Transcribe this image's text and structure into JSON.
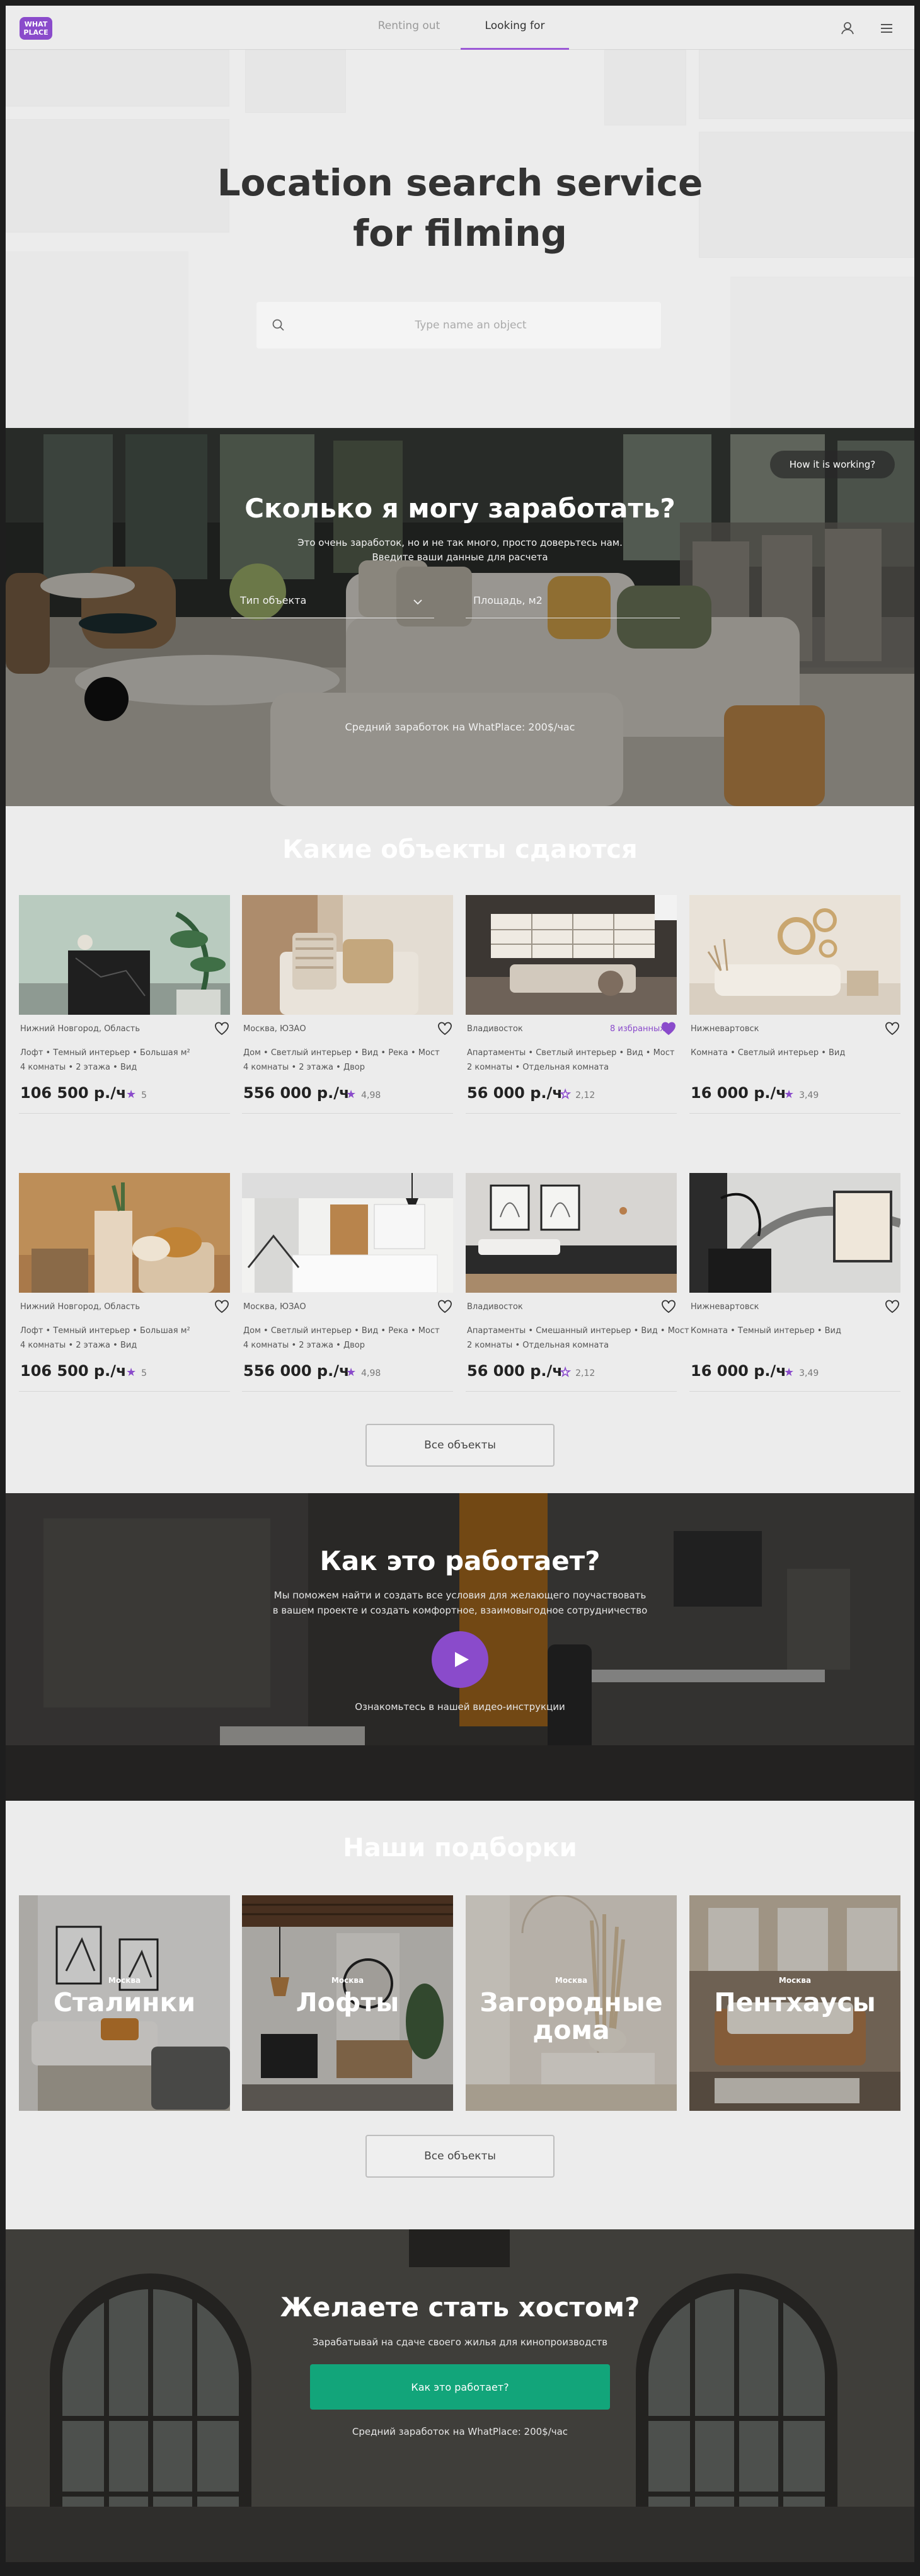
{
  "header": {
    "logo_line1": "WHAT",
    "logo_line2": "PLACE",
    "tabs": [
      {
        "label": "Renting out",
        "active": false
      },
      {
        "label": "Looking for",
        "active": true
      }
    ],
    "icons": [
      "user-icon",
      "menu-icon"
    ],
    "accent": "#9b59d6"
  },
  "hero": {
    "title_line1": "Location search service",
    "title_line2": "for filming",
    "search_placeholder": "Type name an object",
    "search_value": ""
  },
  "earn": {
    "how_button": "How it is working?",
    "title": "Сколько я могу заработать?",
    "subtitle_line1": "Это очень заработок, но и не так много, просто доверьтесь нам.",
    "subtitle_line2": "Введите ваши данные для расчета",
    "type_placeholder": "Тип объекта",
    "area_placeholder": "Площадь, м2",
    "result": "Средний заработок на WhatPlace: 200$/час"
  },
  "objects": {
    "title": "Какие объекты сдаются",
    "favorite_label": "8 избранных",
    "cards": [
      {
        "location": "Нижний Новгород, Область",
        "tags": "Лофт • Темный интерьер • Большая м²",
        "rooms": "4 комнаты • 2 этажа • Вид",
        "price": "106 500 р./ч",
        "rating": "5",
        "favorite": false
      },
      {
        "location": "Москва, ЮЗАО",
        "tags": "Дом • Светлый интерьер • Вид • Река • Мост",
        "rooms": "4 комнаты • 2 этажа • Двор",
        "price": "556 000 р./ч",
        "rating": "4,98",
        "favorite": false
      },
      {
        "location": "Владивосток",
        "tags": "Апартаменты • Светлый интерьер • Вид • Мост",
        "rooms": "2 комнаты • Отдельная комната",
        "price": "56 000 р./ч",
        "rating": "2,12",
        "favorite": true
      },
      {
        "location": "Нижневартовск",
        "tags": "Комната • Светлый интерьер • Вид",
        "rooms": "",
        "price": "16 000 р./ч",
        "rating": "3,49",
        "favorite": false
      },
      {
        "location": "Нижний Новгород, Область",
        "tags": "Лофт • Темный интерьер • Большая м²",
        "rooms": "4 комнаты • 2 этажа • Вид",
        "price": "106 500 р./ч",
        "rating": "5",
        "favorite": false
      },
      {
        "location": "Москва, ЮЗАО",
        "tags": "Дом • Светлый интерьер • Вид • Река • Мост",
        "rooms": "4 комнаты • 2 этажа • Двор",
        "price": "556 000 р./ч",
        "rating": "4,98",
        "favorite": false
      },
      {
        "location": "Владивосток",
        "tags": "Апартаменты • Смешанный интерьер • Вид • Мост",
        "rooms": "2 комнаты • Отдельная комната",
        "price": "56 000 р./ч",
        "rating": "2,12",
        "favorite": false
      },
      {
        "location": "Нижневартовск",
        "tags": "Комната • Темный интерьер • Вид",
        "rooms": "",
        "price": "16 000 р./ч",
        "rating": "3,49",
        "favorite": false
      }
    ],
    "all_button": "Все объекты"
  },
  "how": {
    "title": "Как это работает?",
    "text_line1": "Мы поможем найти и создать все условия для желающего поучаствовать",
    "text_line2": "в вашем проекте и создать комфортное, взаимовыгодное сотрудничество",
    "video_label": "Ознакомьтесь в нашей видео-инструкции"
  },
  "sets": {
    "title": "Наши подборки",
    "items": [
      {
        "city": "Москва",
        "name_line1": "Сталинки",
        "name_line2": ""
      },
      {
        "city": "Москва",
        "name_line1": "Лофты",
        "name_line2": ""
      },
      {
        "city": "Москва",
        "name_line1": "Загородные",
        "name_line2": "дома"
      },
      {
        "city": "Москва",
        "name_line1": "Пентхаусы",
        "name_line2": ""
      }
    ],
    "all_button": "Все объекты"
  },
  "host": {
    "title": "Желаете стать хостом?",
    "subtitle": "Зарабатывай на сдаче своего жилья для кинопроизводств",
    "cta": "Как это работает?",
    "note": "Средний заработок на WhatPlace: 200$/час",
    "cta_color": "#12a57a"
  }
}
